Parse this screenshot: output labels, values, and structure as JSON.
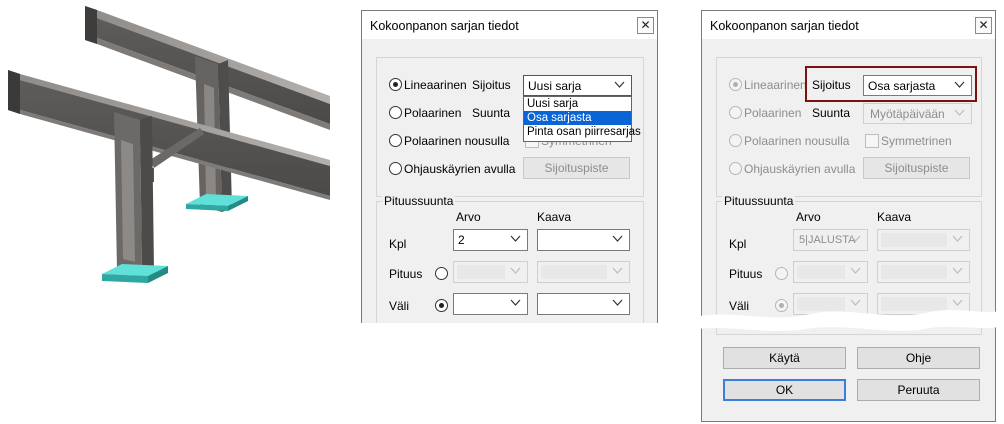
{
  "dialog_left": {
    "title": "Kokoonpanon sarjan tiedot",
    "close_label": "✕",
    "methods": {
      "linear": "Lineaarinen",
      "polar": "Polaarinen",
      "polar_rising": "Polaarinen nousulla",
      "curves": "Ohjauskäyrien avulla"
    },
    "placement_label": "Sijoitus",
    "placement_value": "Uusi sarja",
    "placement_options": [
      "Uusi sarja",
      "Osa sarjasta",
      "Pinta osan piirresarjas"
    ],
    "selected_option": "Osa sarjasta",
    "direction_label": "Suunta",
    "symmetric_label": "Symmetrinen",
    "placement_point_button": "Sijoituspiste",
    "length_group": "Pituussuunta",
    "col_value": "Arvo",
    "col_formula": "Kaava",
    "row_count": "Kpl",
    "row_length": "Pituus",
    "row_spacing": "Väli",
    "count_value": "2"
  },
  "dialog_right": {
    "title": "Kokoonpanon sarjan tiedot",
    "close_label": "✕",
    "methods": {
      "linear": "Lineaarinen",
      "polar": "Polaarinen",
      "polar_rising": "Polaarinen nousulla",
      "curves": "Ohjauskäyrien avulla"
    },
    "placement_label": "Sijoitus",
    "placement_value": "Osa sarjasta",
    "direction_label": "Suunta",
    "direction_value": "Myötäpäivään",
    "symmetric_label": "Symmetrinen",
    "placement_point_button": "Sijoituspiste",
    "length_group": "Pituussuunta",
    "col_value": "Arvo",
    "col_formula": "Kaava",
    "row_count": "Kpl",
    "row_length": "Pituus",
    "row_spacing": "Väli",
    "count_value": "5|JALUSTA",
    "buttons": {
      "apply": "Käytä",
      "help": "Ohje",
      "ok": "OK",
      "cancel": "Peruuta"
    }
  },
  "colors": {
    "steel": "#6f6d6b",
    "base_plate": "#40c9c2",
    "selection": "#0a64d6",
    "highlight_box": "#7a1212"
  }
}
